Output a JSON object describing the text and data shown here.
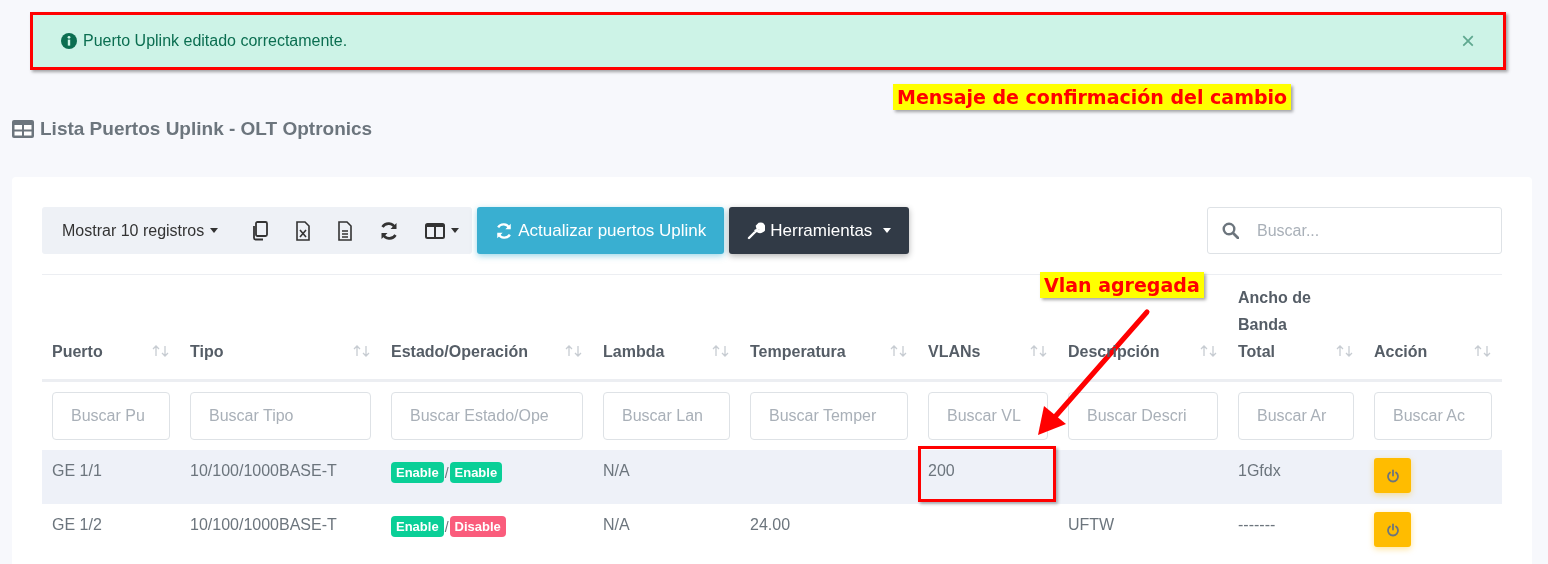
{
  "alert": {
    "message": "Puerto Uplink editado correctamente.",
    "closable": true,
    "close_label": "×",
    "marked": true
  },
  "annotations": [
    {
      "kind": "note",
      "text": "Mensaje de confirmación del cambio"
    },
    {
      "kind": "arrow-note",
      "text": "Vlan agregada"
    }
  ],
  "title": "Lista Puertos Uplink - OLT Optronics",
  "toolbar": {
    "length_menu": "Mostrar 10 registros",
    "update_button": "Actualizar puertos Uplink",
    "tools_button": "Herramientas",
    "search": {
      "placeholder": "Buscar..."
    }
  },
  "table": {
    "columns": [
      {
        "label": "Puerto",
        "placeholder": "Buscar Pu"
      },
      {
        "label": "Tipo",
        "placeholder": "Buscar Tipo"
      },
      {
        "label": "Estado/Operación",
        "placeholder": "Buscar Estado/Ope"
      },
      {
        "label": "Lambda",
        "placeholder": "Buscar Lan"
      },
      {
        "label": "Temperatura",
        "placeholder": "Buscar Temper"
      },
      {
        "label": "VLANs",
        "placeholder": "Buscar VL"
      },
      {
        "label": "Descripción",
        "placeholder": "Buscar Descri"
      },
      {
        "label": "Ancho de Banda Total",
        "placeholder": "Buscar Ar"
      },
      {
        "label": "Acción",
        "placeholder": "Buscar Ac"
      }
    ],
    "rows": [
      {
        "puerto": "GE 1/1",
        "tipo": "10/100/1000BASE-T",
        "estado": {
          "text": "Enable",
          "color": "#0acf97"
        },
        "separator": "/",
        "operacion": {
          "text": "Enable",
          "color": "#0acf97"
        },
        "lambda": "N/A",
        "temperatura": "",
        "vlans": "200",
        "vlans_marked": true,
        "descripcion": "",
        "ancho": "1Gfdx"
      },
      {
        "puerto": "GE 1/2",
        "tipo": "10/100/1000BASE-T",
        "estado": {
          "text": "Enable",
          "color": "#0acf97"
        },
        "separator": "/",
        "operacion": {
          "text": "Disable",
          "color": "#fa5c7c"
        },
        "lambda": "N/A",
        "temperatura": "24.00",
        "vlans": "",
        "vlans_marked": false,
        "descripcion": "UFTW",
        "ancho": "-------"
      }
    ]
  }
}
